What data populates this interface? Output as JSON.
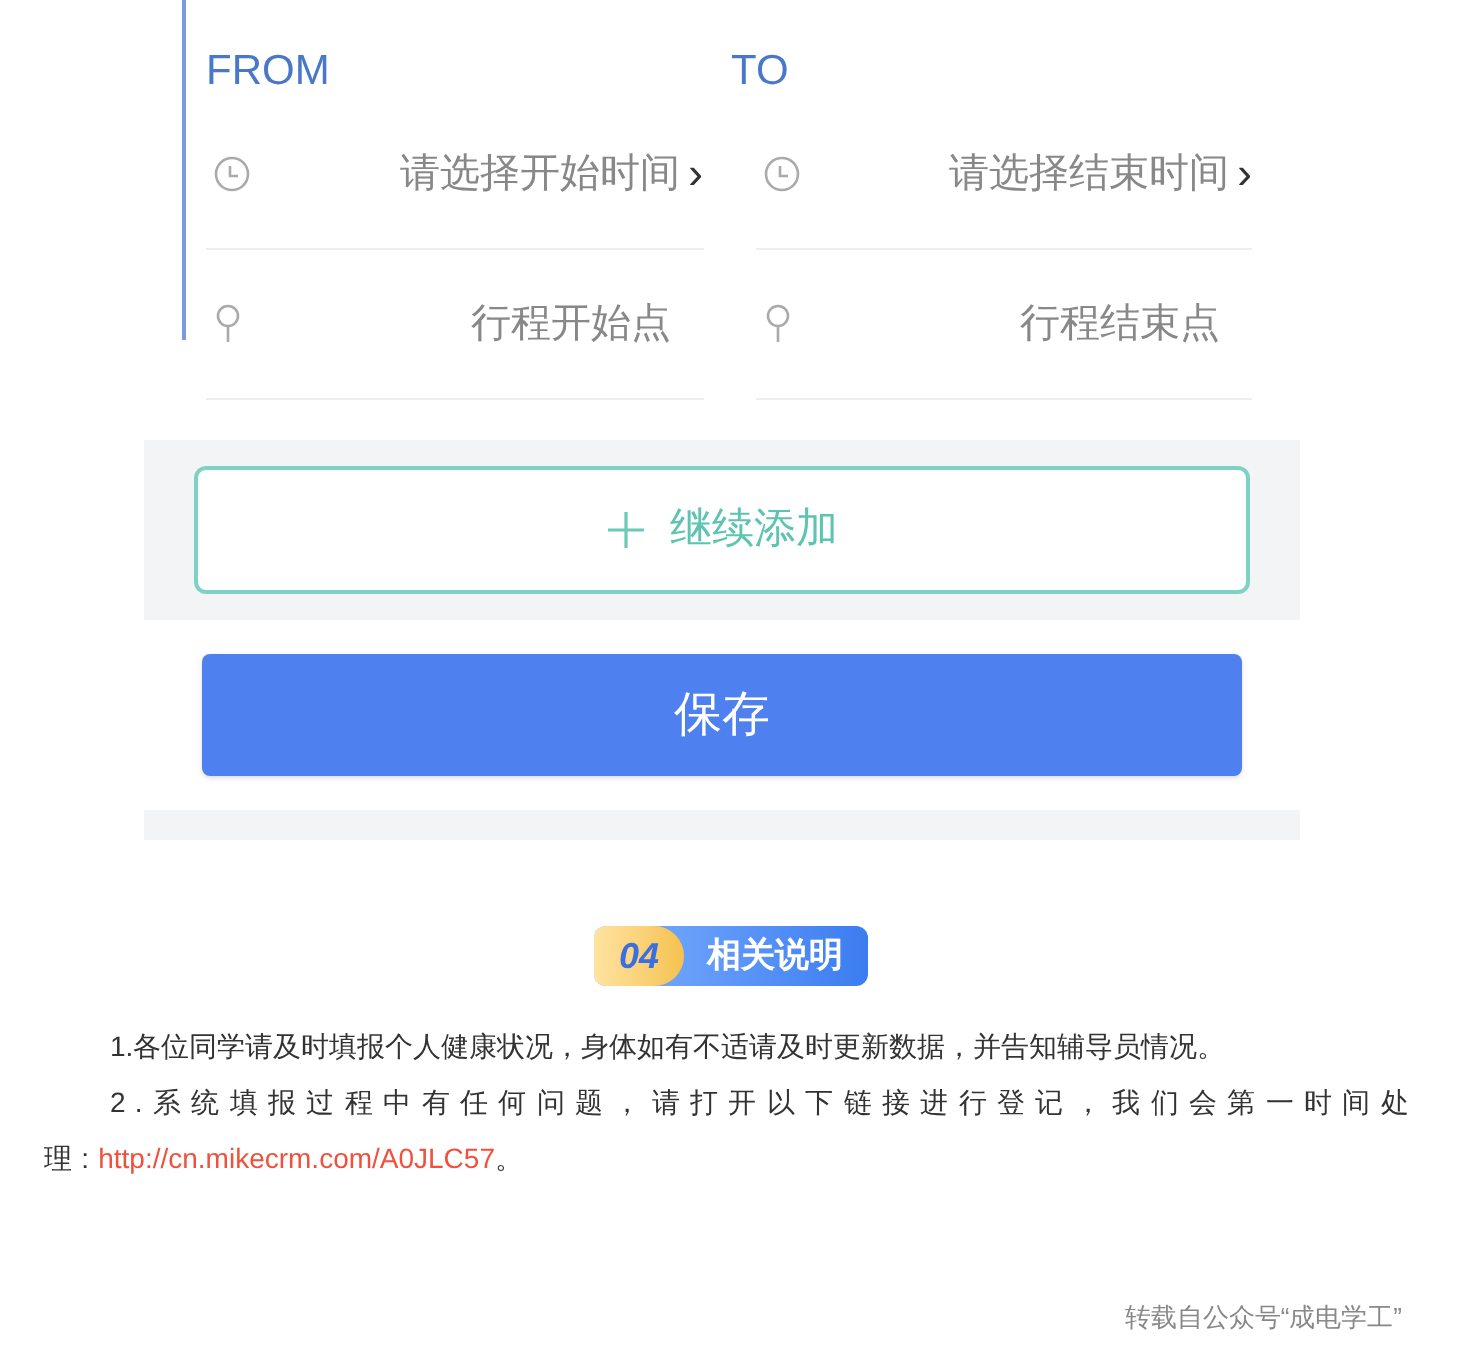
{
  "form": {
    "from_label": "FROM",
    "to_label": "TO",
    "fields": [
      {
        "kind": "time",
        "placeholder": "请选择开始时间",
        "arrow": "›"
      },
      {
        "kind": "time",
        "placeholder": "请选择结束时间",
        "arrow": "›"
      },
      {
        "kind": "place",
        "placeholder": "行程开始点"
      },
      {
        "kind": "place",
        "placeholder": "行程结束点"
      }
    ],
    "add_button": "继续添加",
    "save_button": "保存"
  },
  "section": {
    "number": "04",
    "title": "相关说明"
  },
  "notes": [
    {
      "text": "1.各位同学请及时填报个人健康状况，身体如有不适请及时更新数据，并告知辅导员情况。"
    },
    {
      "text": "2.系统填报过程中有任何问题，请打开以下链接进行登记，我们会第一时间处理:",
      "link": "http://cn.mikecrm.com/A0JLC57",
      "after": "。"
    }
  ],
  "footer": "转载自公众号“成电学工”"
}
